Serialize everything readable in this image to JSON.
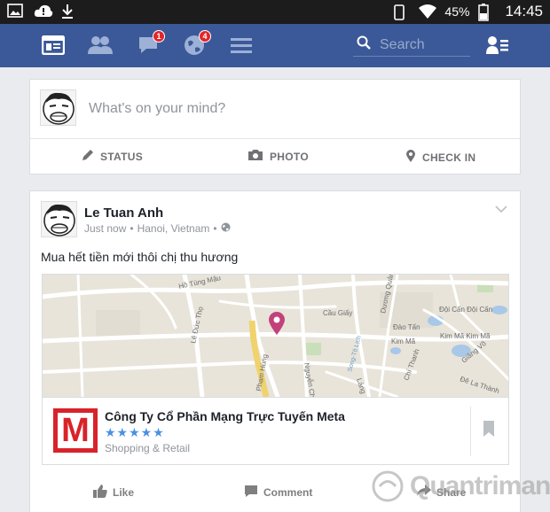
{
  "status_bar": {
    "battery": "45%",
    "time": "14:45"
  },
  "nav": {
    "messages_badge": "1",
    "notifications_badge": "4",
    "search_placeholder": "Search"
  },
  "composer": {
    "prompt": "What's on your mind?",
    "actions": [
      "STATUS",
      "PHOTO",
      "CHECK IN"
    ]
  },
  "post": {
    "author": "Le Tuan Anh",
    "time": "Just now",
    "location": "Hanoi, Vietnam",
    "separator": "•",
    "message": "Mua hết tiền mới thôi chị thu hương",
    "map_labels": [
      "Hồ Tùng Mậu",
      "Lê Đức Thọ",
      "Phạm Hùng",
      "Cầu Giấy",
      "Dương Quảng Hàm",
      "Đào Tấn",
      "Kim Mã",
      "Kim Mã Kim Mã",
      "Đội Cấn Đội Cấn",
      "Giảng Võ",
      "Đê La Thành",
      "Chí Thanh",
      "Láng",
      "Nguyễn Chí Thanh",
      "Song-Tô Lịch"
    ],
    "place": {
      "name": "Công Ty Cổ Phần Mạng Trực Tuyến Meta",
      "logo_letter": "M",
      "stars": "★★★★★",
      "rating": 5,
      "category": "Shopping & Retail"
    },
    "actions": {
      "like": "Like",
      "comment": "Comment",
      "share": "Share"
    }
  },
  "watermark": "Quantrimang",
  "colors": {
    "nav_blue": "#3b5998",
    "badge_red": "#e2262a",
    "pin": "#c2417b",
    "logo_red": "#d8232a",
    "stars": "#4a90e2"
  }
}
